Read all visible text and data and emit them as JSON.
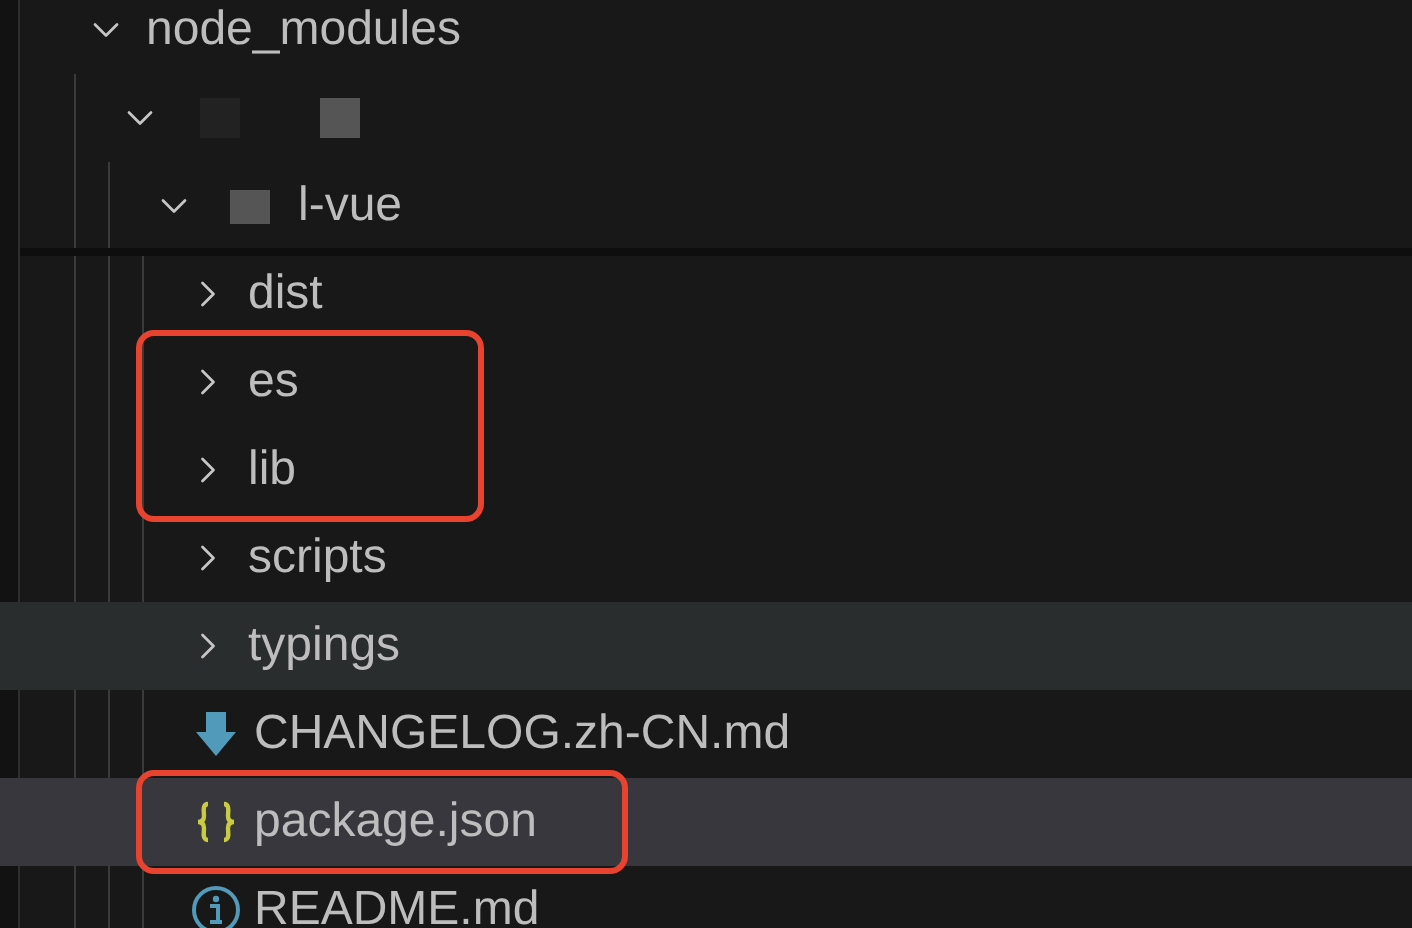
{
  "explorer": {
    "tree": [
      {
        "kind": "folder",
        "name": "node_modules",
        "expanded": true,
        "children": [
          {
            "kind": "folder",
            "redacted": true,
            "expanded": true,
            "children": [
              {
                "kind": "folder",
                "name": "l-vue",
                "redacted": true,
                "expanded": true,
                "children": [
                  {
                    "kind": "folder",
                    "name": "dist",
                    "expanded": false,
                    "selected": false,
                    "hovered": false
                  },
                  {
                    "kind": "folder",
                    "name": "es",
                    "expanded": false,
                    "selected": false,
                    "hovered": false,
                    "outlined": true
                  },
                  {
                    "kind": "folder",
                    "name": "lib",
                    "expanded": false,
                    "selected": false,
                    "hovered": false,
                    "outlined": true
                  },
                  {
                    "kind": "folder",
                    "name": "scripts",
                    "expanded": false,
                    "selected": false,
                    "hovered": false
                  },
                  {
                    "kind": "folder",
                    "name": "typings",
                    "expanded": false,
                    "selected": false,
                    "hovered": true
                  },
                  {
                    "kind": "markdown",
                    "name": "CHANGELOG.zh-CN.md",
                    "selected": false,
                    "hovered": false
                  },
                  {
                    "kind": "json",
                    "name": "package.json",
                    "selected": true,
                    "hovered": false,
                    "outlined": true
                  },
                  {
                    "kind": "info",
                    "name": "README.md",
                    "selected": false,
                    "hovered": false
                  }
                ]
              }
            ]
          }
        ]
      }
    ]
  }
}
